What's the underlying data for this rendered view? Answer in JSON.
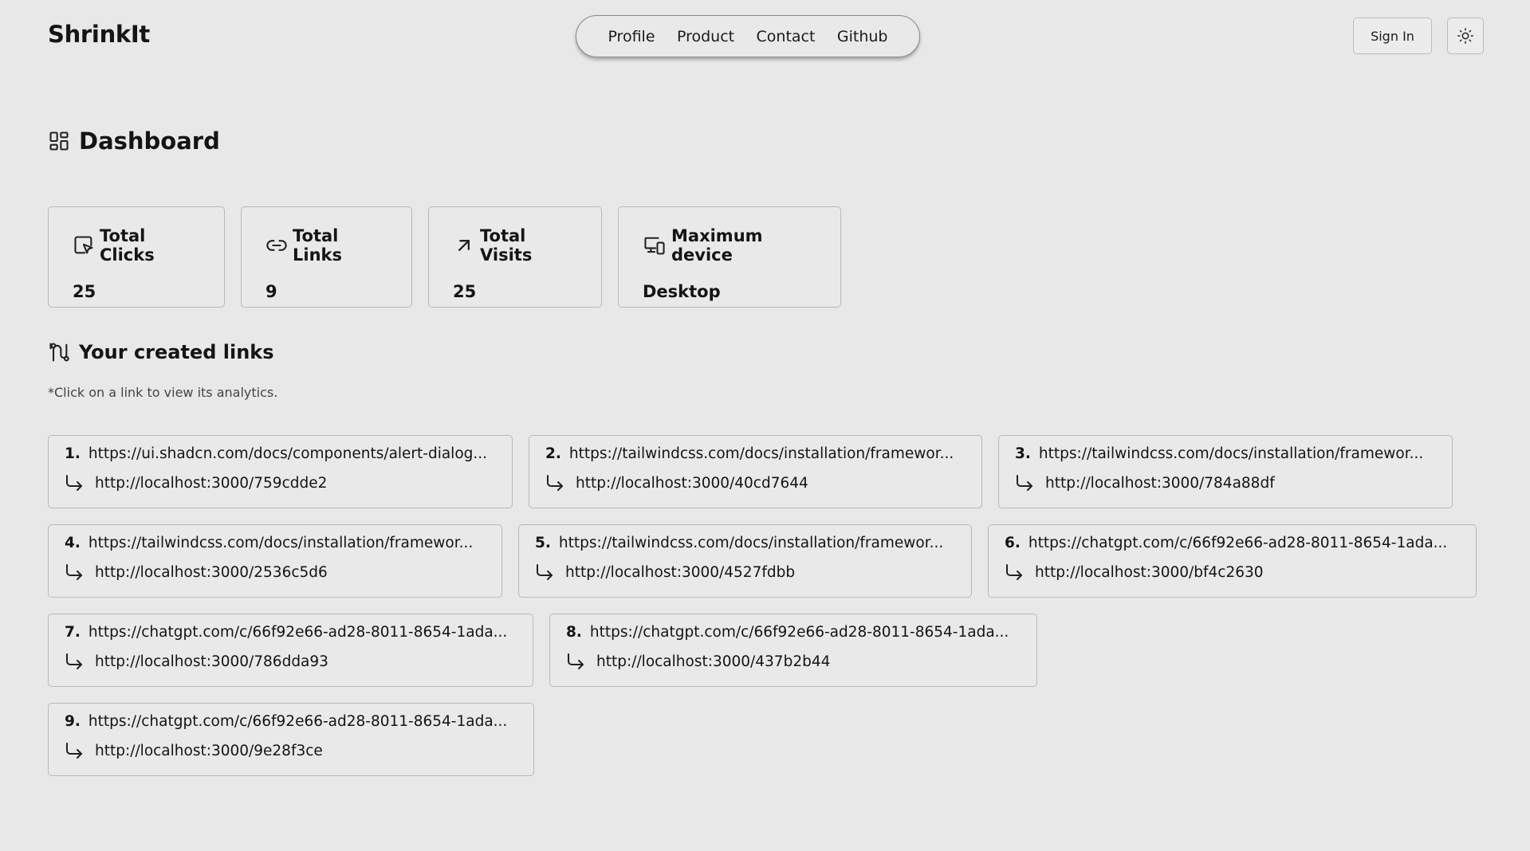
{
  "header": {
    "brand": "ShrinkIt",
    "nav": [
      "Profile",
      "Product",
      "Contact",
      "Github"
    ],
    "sign_in": "Sign In",
    "theme_icon": "sun-icon"
  },
  "dashboard": {
    "title": "Dashboard",
    "title_icon": "layout-grid-icon"
  },
  "stats": [
    {
      "label": "Total Clicks",
      "value": "25",
      "icon": "cursor-click-icon"
    },
    {
      "label": "Total Links",
      "value": "9",
      "icon": "link-icon"
    },
    {
      "label": "Total Visits",
      "value": "25",
      "icon": "arrow-up-right-icon"
    },
    {
      "label": "Maximum device",
      "value": "Desktop",
      "icon": "devices-icon"
    }
  ],
  "links_section": {
    "title": "Your created links",
    "title_icon": "route-icon",
    "hint": "*Click on a link to view its analytics."
  },
  "links": [
    {
      "num": "1.",
      "original": "https://ui.shadcn.com/docs/components/alert-dialog...",
      "short": "http://localhost:3000/759cdde2"
    },
    {
      "num": "2.",
      "original": "https://tailwindcss.com/docs/installation/framewor...",
      "short": "http://localhost:3000/40cd7644"
    },
    {
      "num": "3.",
      "original": "https://tailwindcss.com/docs/installation/framewor...",
      "short": "http://localhost:3000/784a88df"
    },
    {
      "num": "4.",
      "original": "https://tailwindcss.com/docs/installation/framewor...",
      "short": "http://localhost:3000/2536c5d6"
    },
    {
      "num": "5.",
      "original": "https://tailwindcss.com/docs/installation/framewor...",
      "short": "http://localhost:3000/4527fdbb"
    },
    {
      "num": "6.",
      "original": "https://chatgpt.com/c/66f92e66-ad28-8011-8654-1ada...",
      "short": "http://localhost:3000/bf4c2630"
    },
    {
      "num": "7.",
      "original": "https://chatgpt.com/c/66f92e66-ad28-8011-8654-1ada...",
      "short": "http://localhost:3000/786dda93"
    },
    {
      "num": "8.",
      "original": "https://chatgpt.com/c/66f92e66-ad28-8011-8654-1ada...",
      "short": "http://localhost:3000/437b2b44"
    },
    {
      "num": "9.",
      "original": "https://chatgpt.com/c/66f92e66-ad28-8011-8654-1ada...",
      "short": "http://localhost:3000/9e28f3ce"
    }
  ]
}
